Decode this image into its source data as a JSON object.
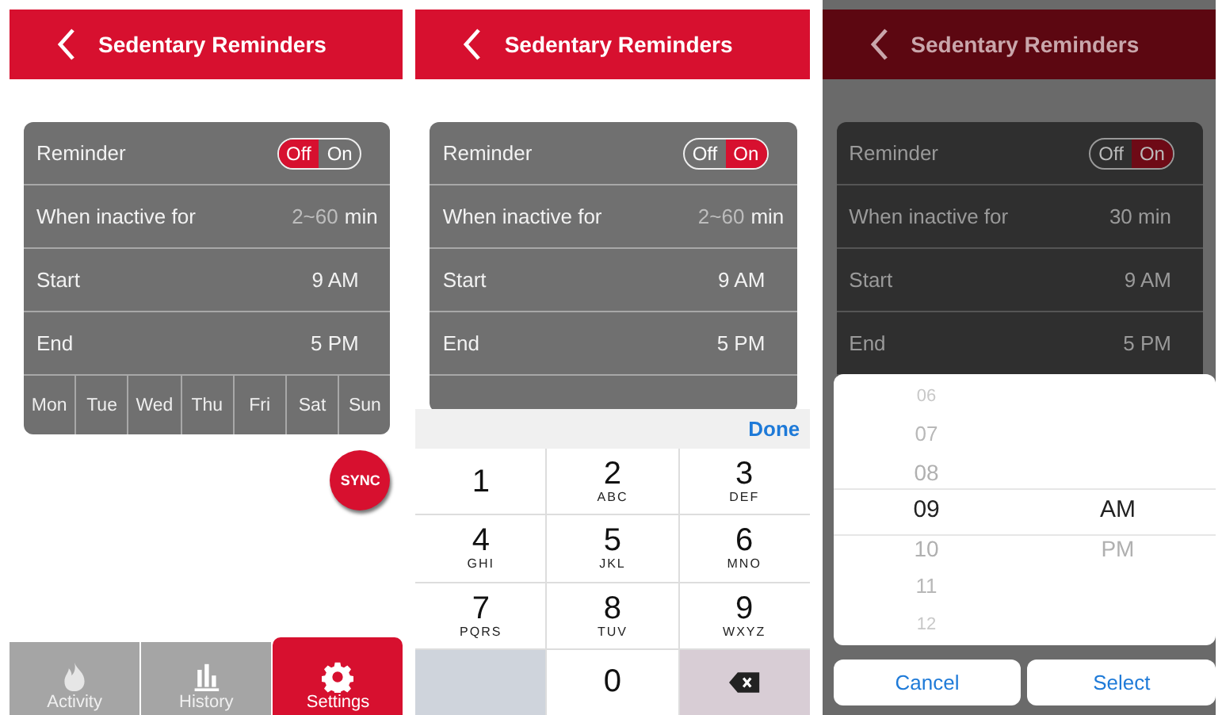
{
  "screens": [
    {
      "title": "Sedentary Reminders",
      "dimmed": false,
      "reminder": {
        "label": "Reminder",
        "options": [
          "Off",
          "On"
        ],
        "on": false
      },
      "rows": [
        {
          "kind": "input",
          "label": "When inactive for",
          "placeholder": "2~60",
          "unit": "min"
        },
        {
          "kind": "time",
          "label": "Start",
          "value": "9 AM"
        },
        {
          "kind": "time",
          "label": "End",
          "value": "5 PM"
        }
      ],
      "days": [
        "Mon",
        "Tue",
        "Wed",
        "Thu",
        "Fri",
        "Sat",
        "Sun"
      ],
      "sync": "SYNC",
      "tabs": [
        {
          "label": "Activity",
          "selected": false
        },
        {
          "label": "History",
          "selected": false
        },
        {
          "label": "Settings",
          "selected": true
        }
      ]
    },
    {
      "title": "Sedentary Reminders",
      "dimmed": false,
      "reminder": {
        "label": "Reminder",
        "options": [
          "Off",
          "On"
        ],
        "on": true
      },
      "rows": [
        {
          "kind": "input",
          "label": "When inactive for",
          "placeholder": "2~60",
          "unit": "min"
        },
        {
          "kind": "time",
          "label": "Start",
          "value": "9 AM"
        },
        {
          "kind": "time",
          "label": "End",
          "value": "5 PM"
        }
      ],
      "keypad": {
        "done": "Done",
        "keys": [
          {
            "kind": "digit",
            "digit": "1"
          },
          {
            "kind": "digit",
            "digit": "2",
            "letters": "ABC"
          },
          {
            "kind": "digit",
            "digit": "3",
            "letters": "DEF"
          },
          {
            "kind": "digit",
            "digit": "4",
            "letters": "GHI"
          },
          {
            "kind": "digit",
            "digit": "5",
            "letters": "JKL"
          },
          {
            "kind": "digit",
            "digit": "6",
            "letters": "MNO"
          },
          {
            "kind": "digit",
            "digit": "7",
            "letters": "PQRS"
          },
          {
            "kind": "digit",
            "digit": "8",
            "letters": "TUV"
          },
          {
            "kind": "digit",
            "digit": "9",
            "letters": "WXYZ"
          },
          {
            "kind": "blank"
          },
          {
            "kind": "digit",
            "digit": "0"
          },
          {
            "kind": "delete"
          }
        ]
      }
    },
    {
      "title": "Sedentary Reminders",
      "dimmed": true,
      "reminder": {
        "label": "Reminder",
        "options": [
          "Off",
          "On"
        ],
        "on": true
      },
      "rows": [
        {
          "kind": "time",
          "label": "When inactive for",
          "value": "30 min"
        },
        {
          "kind": "time",
          "label": "Start",
          "value": "9 AM"
        },
        {
          "kind": "time",
          "label": "End",
          "value": "5 PM"
        }
      ],
      "picker": {
        "hours": [
          {
            "label": "06",
            "selected": false
          },
          {
            "label": "07",
            "selected": false
          },
          {
            "label": "08",
            "selected": false
          },
          {
            "label": "09",
            "selected": true
          },
          {
            "label": "10",
            "selected": false
          },
          {
            "label": "11",
            "selected": false
          },
          {
            "label": "12",
            "selected": false
          }
        ],
        "periods": [
          {
            "label": "AM",
            "selected": true
          },
          {
            "label": "PM",
            "selected": false
          }
        ],
        "buttons": [
          "Cancel",
          "Select"
        ]
      }
    }
  ]
}
